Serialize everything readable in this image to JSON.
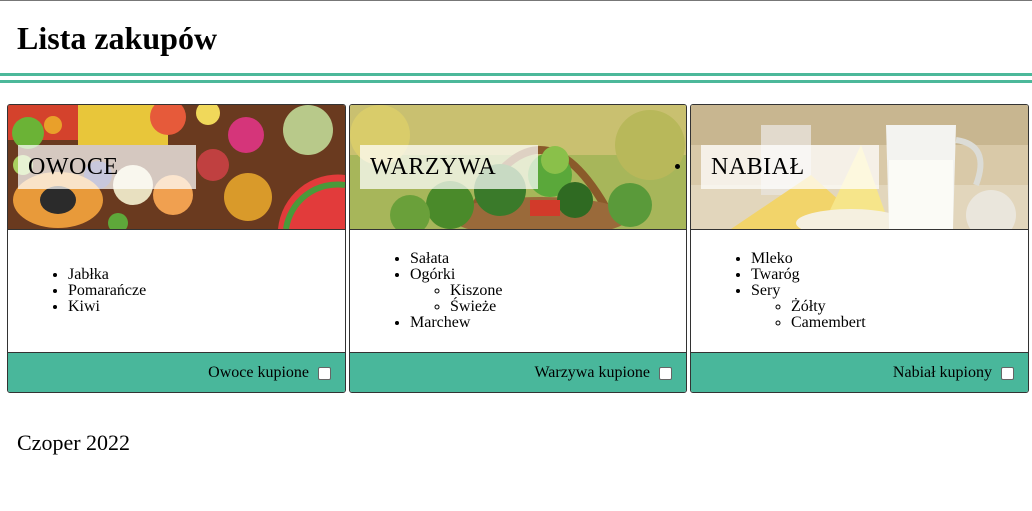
{
  "header": {
    "title": "Lista zakupów"
  },
  "colors": {
    "accent": "#4cb89a",
    "footer": "#49b79b"
  },
  "cards": [
    {
      "title": "OWOCE",
      "image": "fruit-photo",
      "items": [
        "Jabłka",
        "Pomarańcze",
        "Kiwi"
      ],
      "checkbox_label": "Owoce kupione",
      "checked": false
    },
    {
      "title": "WARZYWA",
      "image": "vegetable-basket-photo",
      "items": [
        "Sałata",
        "Ogórki",
        "Marchew"
      ],
      "subitems": {
        "Ogórki": [
          "Kiszone",
          "Świeże"
        ]
      },
      "checkbox_label": "Warzywa kupione",
      "checked": false
    },
    {
      "title": "NABIAŁ",
      "image": "dairy-photo",
      "items": [
        "Mleko",
        "Twaróg",
        "Sery"
      ],
      "subitems": {
        "Sery": [
          "Żółty",
          "Camembert"
        ]
      },
      "checkbox_label": "Nabiał kupiony",
      "checked": false
    }
  ],
  "footer": {
    "text": "Czoper 2022"
  }
}
